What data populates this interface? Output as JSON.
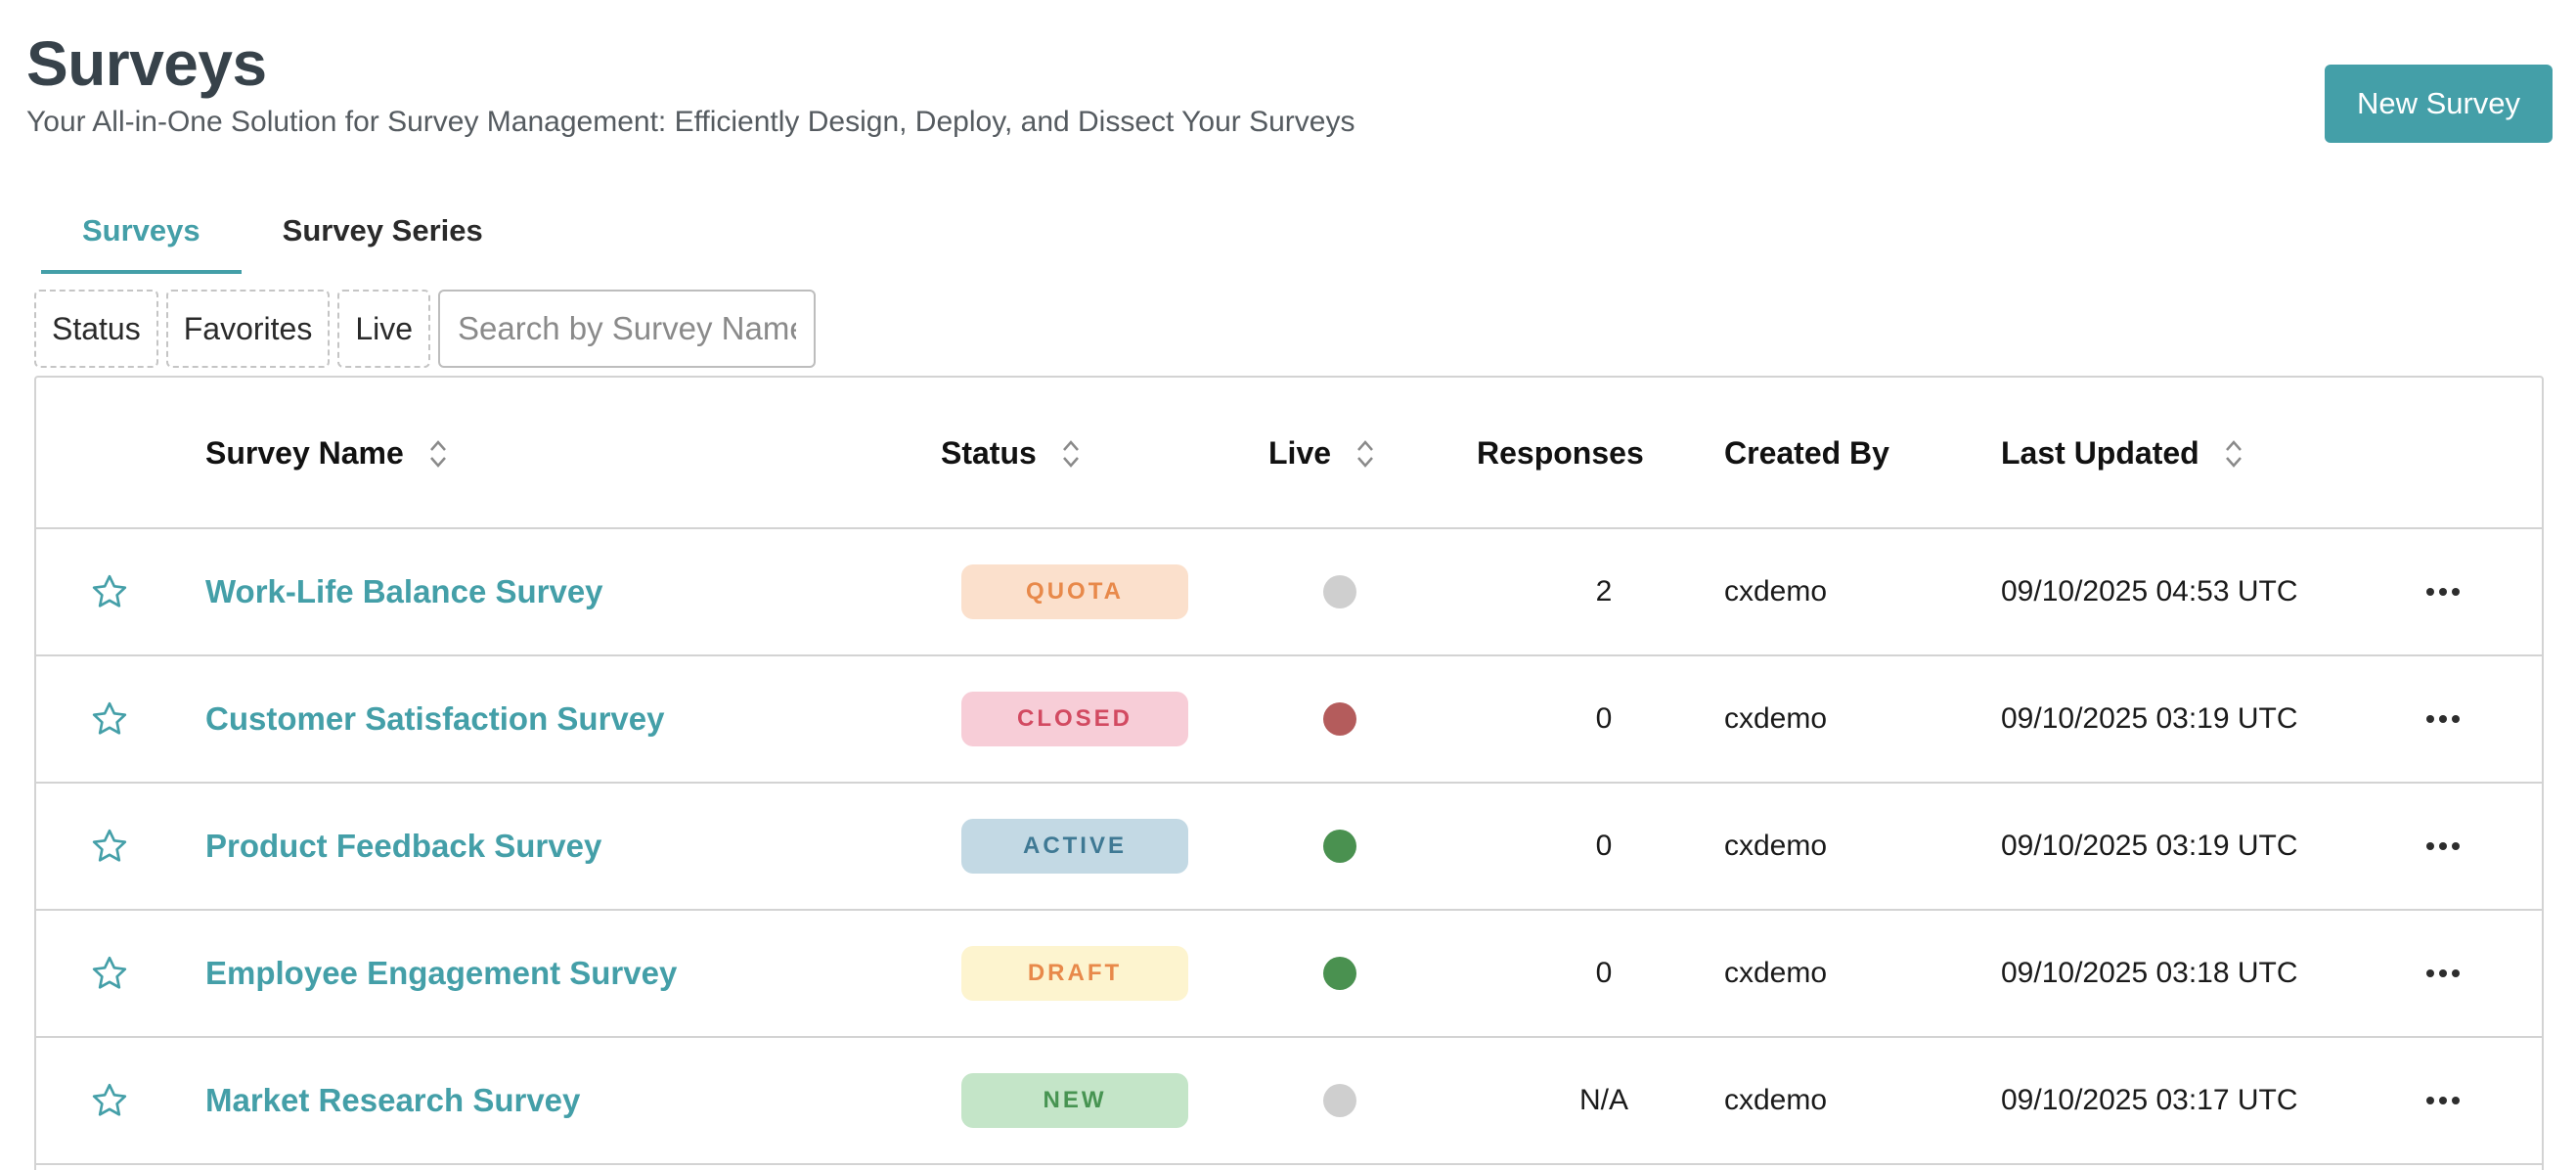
{
  "header": {
    "title": "Surveys",
    "subtitle": "Your All-in-One Solution for Survey Management: Efficiently Design, Deploy, and Dissect Your Surveys",
    "new_button": "New Survey"
  },
  "tabs": [
    {
      "label": "Surveys",
      "active": true
    },
    {
      "label": "Survey Series",
      "active": false
    }
  ],
  "filters": {
    "chips": [
      "Status",
      "Favorites",
      "Live"
    ],
    "search_placeholder": "Search by Survey Name"
  },
  "table": {
    "columns": {
      "name": "Survey Name",
      "status": "Status",
      "live": "Live",
      "responses": "Responses",
      "created_by": "Created By",
      "last_updated": "Last Updated"
    },
    "rows": [
      {
        "name": "Work-Life Balance Survey",
        "status": "QUOTA",
        "live": "gray",
        "responses": "2",
        "created_by": "cxdemo",
        "updated": "09/10/2025 04:53 UTC"
      },
      {
        "name": "Customer Satisfaction Survey",
        "status": "CLOSED",
        "live": "red",
        "responses": "0",
        "created_by": "cxdemo",
        "updated": "09/10/2025 03:19 UTC"
      },
      {
        "name": "Product Feedback Survey",
        "status": "ACTIVE",
        "live": "green",
        "responses": "0",
        "created_by": "cxdemo",
        "updated": "09/10/2025 03:19 UTC"
      },
      {
        "name": "Employee Engagement Survey",
        "status": "DRAFT",
        "live": "green",
        "responses": "0",
        "created_by": "cxdemo",
        "updated": "09/10/2025 03:18 UTC"
      },
      {
        "name": "Market Research Survey",
        "status": "NEW",
        "live": "gray",
        "responses": "N/A",
        "created_by": "cxdemo",
        "updated": "09/10/2025 03:17 UTC"
      }
    ]
  },
  "colors": {
    "accent": "#449fa8",
    "quota_bg": "#fbe0cc",
    "quota_fg": "#e8894a",
    "closed_bg": "#f7cdd7",
    "closed_fg": "#d24a61",
    "active_bg": "#c3d9e4",
    "active_fg": "#3f7994",
    "draft_bg": "#fdf4cf",
    "draft_fg": "#e8894a",
    "new_bg": "#c4e5c8",
    "new_fg": "#479452",
    "dot_gray": "#cfcfcf",
    "dot_red": "#b45c5c",
    "dot_green": "#4a9150"
  },
  "icons": {
    "favorite": "star-outline-icon",
    "sort": "sort-chevrons-icon",
    "row_menu": "more-horizontal-icon"
  }
}
